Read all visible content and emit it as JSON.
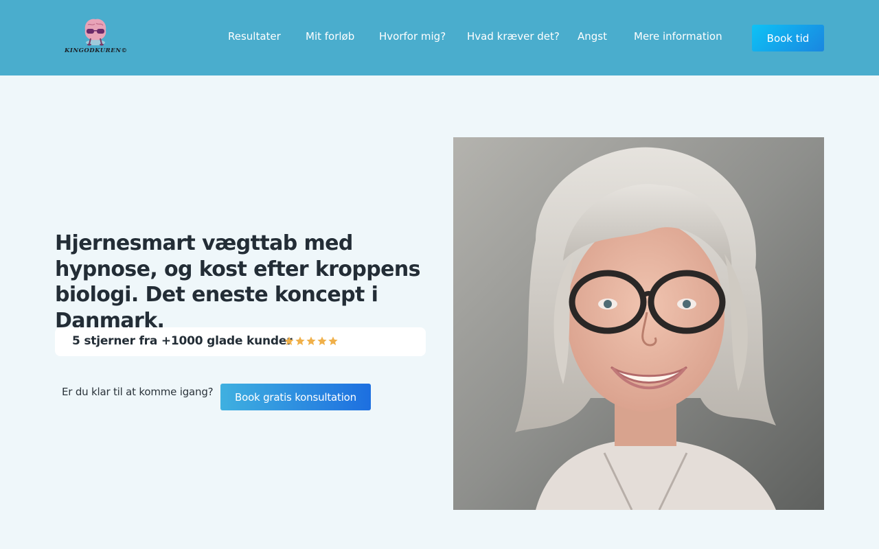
{
  "logo": {
    "icon": "brain-with-sunglasses-icon",
    "text": "KINGODKUREN©"
  },
  "nav": {
    "items": [
      {
        "label": "Resultater"
      },
      {
        "label": "Mit forløb"
      },
      {
        "label": "Hvorfor mig?"
      },
      {
        "label": "Hvad kræver det?"
      },
      {
        "label": "Angst"
      },
      {
        "label": "Mere information"
      }
    ],
    "book_label": "Book tid"
  },
  "hero": {
    "title": "Hjernesmart vægttab med hypnose, og kost efter kroppens biologi. Det eneste koncept i Danmark.",
    "rating": {
      "text": "5 stjerner fra +1000 glade kunder",
      "stars": 5,
      "star_color": "#f0b04a"
    },
    "cta_text": "Er du klar til at komme igang?",
    "cta_button": "Book gratis konsultation"
  },
  "colors": {
    "header_bg": "#4aadcd",
    "page_bg": "#eff7fa",
    "accent_start": "#0ec2f5",
    "accent_end": "#1a86e0"
  }
}
